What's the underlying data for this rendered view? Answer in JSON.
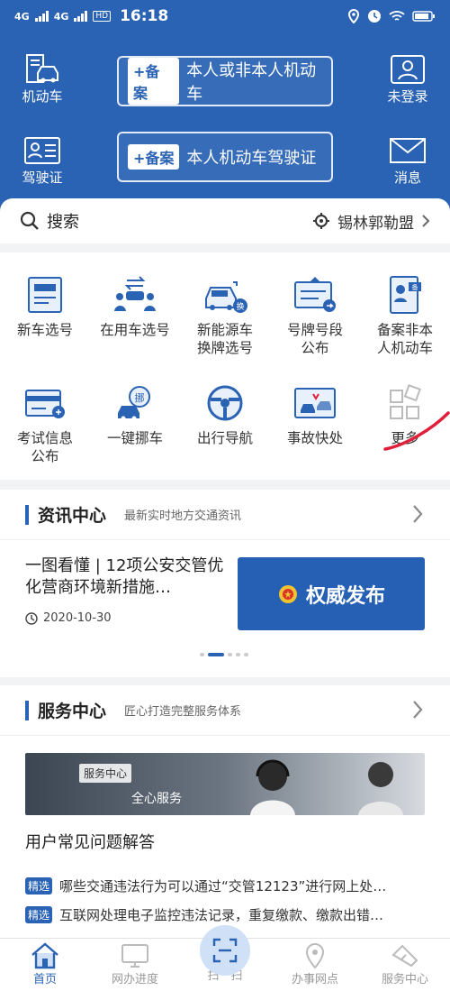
{
  "status_bar": {
    "sig1": "4G",
    "sig2": "4G",
    "hd": "HD",
    "time": "16:18"
  },
  "header": {
    "vehicle_label": "机动车",
    "license_label": "驾驶证",
    "login_label": "未登录",
    "message_label": "消息",
    "register_vehicle": {
      "tag": "+备案",
      "text": "本人或非本人机动车"
    },
    "register_license": {
      "tag": "+备案",
      "text": "本人机动车驾驶证"
    }
  },
  "search": {
    "label": "搜索",
    "location": "锡林郭勒盟"
  },
  "services": [
    {
      "label": "新车选号"
    },
    {
      "label": "在用车选号"
    },
    {
      "label": "新能源车\n换牌选号"
    },
    {
      "label": "号牌号段\n公布"
    },
    {
      "label": "备案非本\n人机动车"
    },
    {
      "label": "考试信息\n公布"
    },
    {
      "label": "一键挪车"
    },
    {
      "label": "出行导航"
    },
    {
      "label": "事故快处"
    },
    {
      "label": "更多"
    }
  ],
  "news": {
    "title": "资讯中心",
    "subtitle": "最新实时地方交通资讯",
    "headline": "一图看懂 | 12项公安交管优化营商环境新措施…",
    "date": "2020-10-30",
    "banner_text": "权威发布"
  },
  "service_center": {
    "title": "服务中心",
    "subtitle": "匠心打造完整服务体系",
    "banner_tag": "服务中心",
    "banner_label": "全心服务",
    "faq_title": "用户常见问题解答",
    "faq": [
      {
        "tag": "精选",
        "text": "哪些交通违法行为可以通过“交管12123”进行网上处…"
      },
      {
        "tag": "精选",
        "text": "互联网处理电子监控违法记录，重复缴款、缴款出错…"
      }
    ]
  },
  "bottom_nav": [
    {
      "label": "首页"
    },
    {
      "label": "网办进度"
    },
    {
      "label": "扫一扫"
    },
    {
      "label": "办事网点"
    },
    {
      "label": "服务中心"
    }
  ],
  "colors": {
    "primary": "#2a63b4",
    "background": "#f2f3f5",
    "annotation": "#e0203a"
  }
}
